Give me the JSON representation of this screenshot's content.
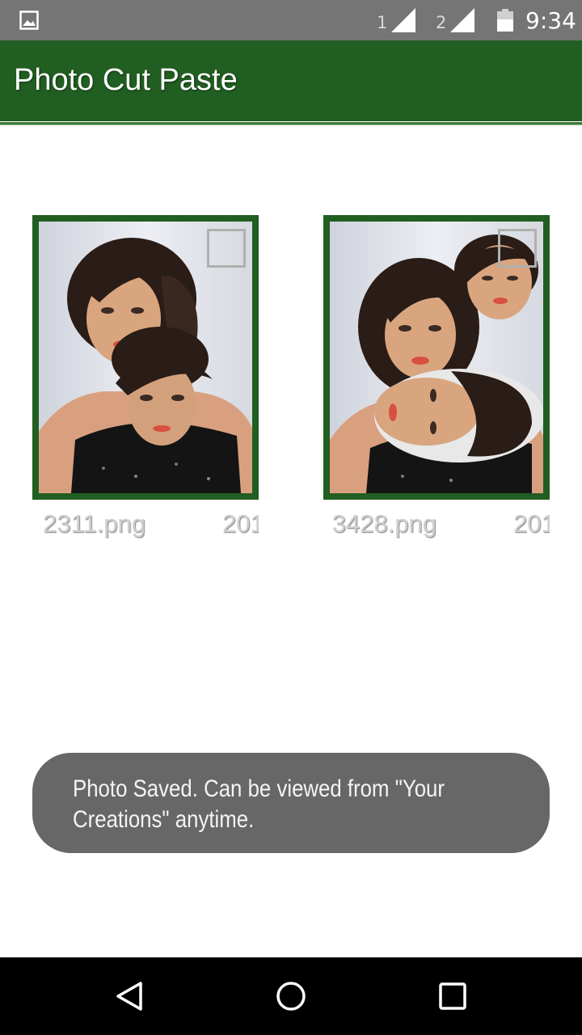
{
  "status_bar": {
    "time": "9:34",
    "sim1_label": "1",
    "sim2_label": "2",
    "icons": [
      "image-notification-icon",
      "signal-icon",
      "signal-icon",
      "battery-icon"
    ]
  },
  "app_bar": {
    "title": "Photo Cut Paste",
    "color": "#215e21"
  },
  "gallery": {
    "items": [
      {
        "name": "2311.png",
        "date": "201",
        "selected": false
      },
      {
        "name": "3428.png",
        "date": "201",
        "selected": false
      }
    ]
  },
  "toast": {
    "message": "Photo Saved. Can be viewed from \"Your Creations\" anytime."
  },
  "nav_bar": {
    "icons": [
      "back-icon",
      "home-icon",
      "recents-icon"
    ]
  }
}
